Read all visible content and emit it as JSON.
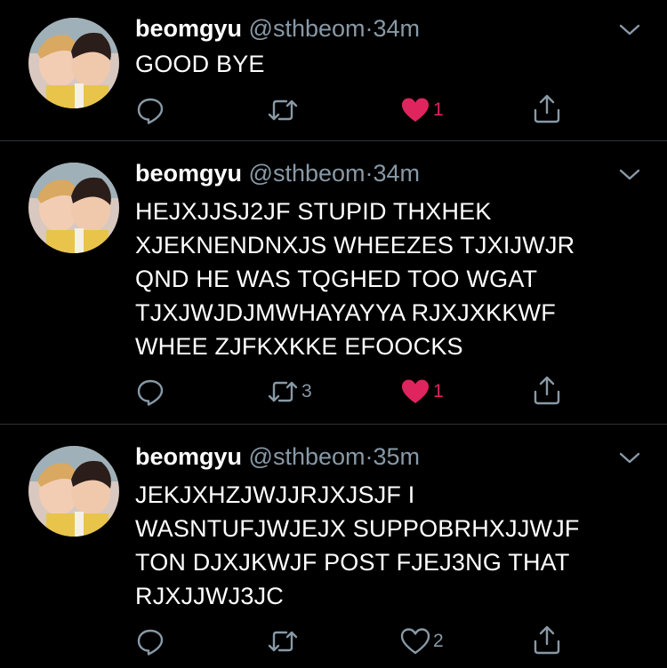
{
  "tweets": [
    {
      "name": "beomgyu",
      "handle": "@sthbeom",
      "dot": "·",
      "time": "34m",
      "lines": [
        "GOOD BYE"
      ],
      "retweets": "",
      "likes": "1",
      "liked": true
    },
    {
      "name": "beomgyu",
      "handle": "@sthbeom",
      "dot": "·",
      "time": "34m",
      "lines": [
        "HEJXJJSJ2JF STUPID THXHEK",
        "XJEKNENDNXJS WHEEZES TJXIJWJR",
        "QND HE WAS TQGHED TOO WGAT",
        "TJXJWJDJMWHAYAYYA RJXJXKKWF",
        "WHEE ZJFKXKKE EFOOCKS"
      ],
      "retweets": "3",
      "likes": "1",
      "liked": true
    },
    {
      "name": "beomgyu",
      "handle": "@sthbeom",
      "dot": "·",
      "time": "35m",
      "lines": [
        "JEKJXHZJWJJRJXJSJF I",
        "WASNTUFJWJEJX SUPPOBRHXJJWJF",
        "TON DJXJKWJF POST FJEJ3NG THAT",
        "RJXJJWJ3JC"
      ],
      "retweets": "",
      "likes": "2",
      "liked": false
    }
  ],
  "colors": {
    "background": "#000000",
    "text": "#ffffff",
    "secondary": "#8899a6",
    "like_active": "#e0245e",
    "divider": "#2f3336"
  },
  "icons": {
    "reply": "reply-icon",
    "retweet": "retweet-icon",
    "like": "heart-icon",
    "share": "share-icon",
    "menu": "chevron-down-icon"
  }
}
